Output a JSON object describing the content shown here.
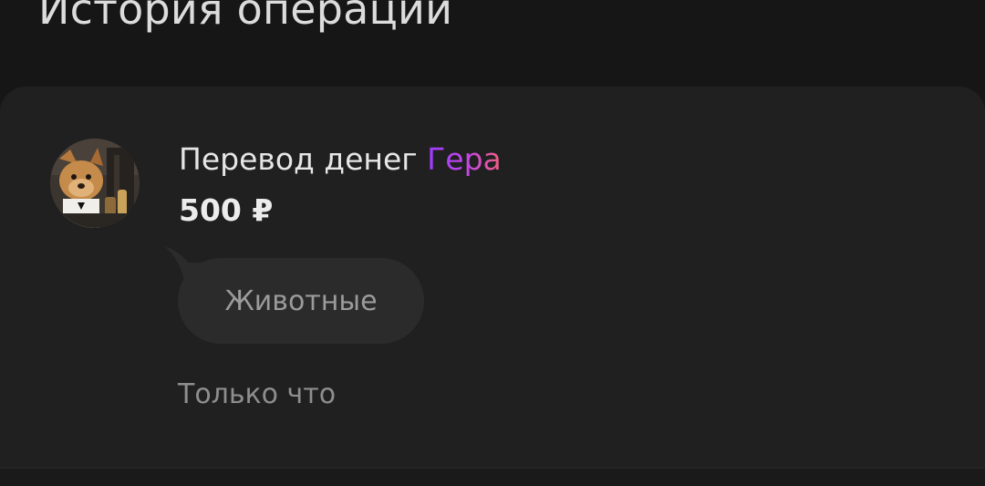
{
  "header": {
    "title": "История операций"
  },
  "operation": {
    "type_label": "Перевод денег",
    "recipient": "Гера",
    "amount": "500 ₽",
    "message": "Животные",
    "time": "Только что",
    "avatar_icon": "user-avatar-photo-icon"
  },
  "colors": {
    "background": "#161616",
    "card": "#202020",
    "bubble": "#2b2b2b",
    "recipient_gradient_start": "#9b3cff",
    "recipient_gradient_end": "#ef5e7c"
  }
}
